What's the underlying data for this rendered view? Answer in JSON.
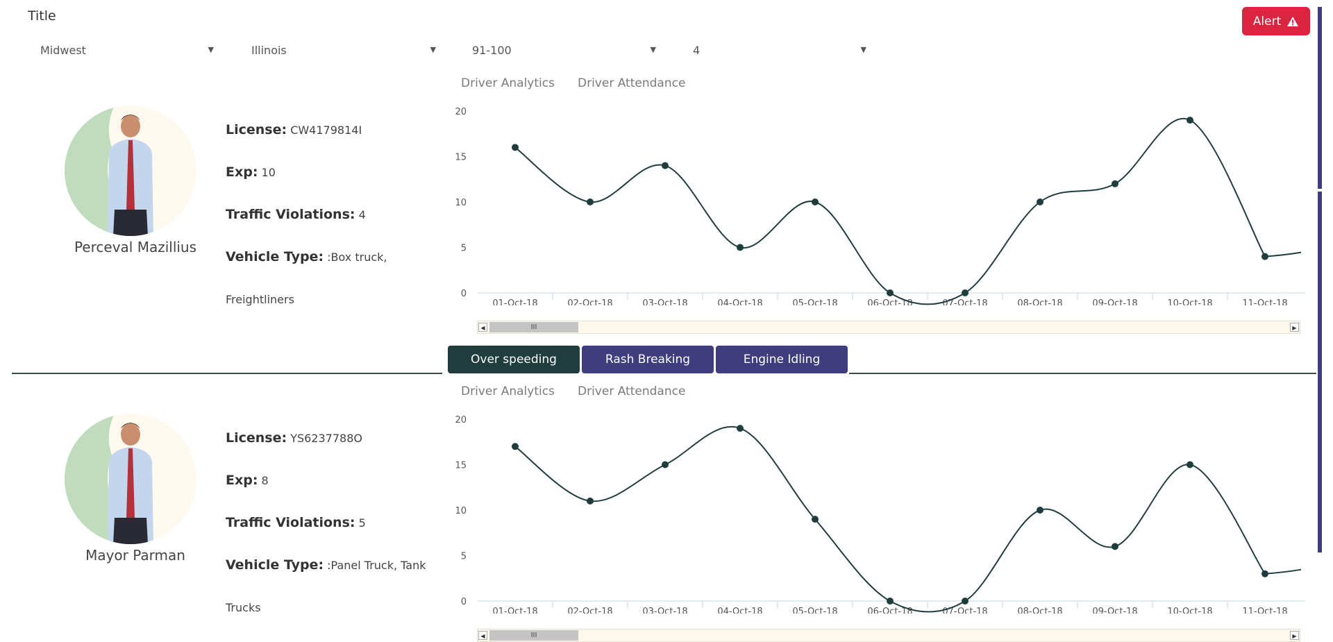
{
  "header": {
    "title": "Title",
    "alert_label": "Alert"
  },
  "filters": [
    {
      "value": "Midwest"
    },
    {
      "value": "Illinois"
    },
    {
      "value": "91-100"
    },
    {
      "value": "4"
    }
  ],
  "metrics": {
    "over_speeding": "Over speeding",
    "rash_breaking": "Rash Breaking",
    "engine_idling": "Engine Idling"
  },
  "colors": {
    "alert": "#dc2340",
    "active_metric": "#1f3d3c",
    "metric": "#3f3d7e",
    "line": "#1f3d3c"
  },
  "drivers": [
    {
      "name": "Perceval Mazillius",
      "license_label": "License:",
      "license": "CW4179814I",
      "exp_label": "Exp:",
      "exp": "10",
      "violations_label": "Traffic Violations:",
      "violations": "4",
      "vehicle_label": "Vehicle Type:",
      "vehicle_line1": ":Box truck,",
      "vehicle_line2": "Freightliners",
      "tabs": [
        "Driver Analytics",
        "Driver Attendance"
      ],
      "chart_data": {
        "type": "line",
        "categories": [
          "01-Oct-18",
          "02-Oct-18",
          "03-Oct-18",
          "04-Oct-18",
          "05-Oct-18",
          "06-Oct-18",
          "07-Oct-18",
          "08-Oct-18",
          "09-Oct-18",
          "10-Oct-18",
          "11-Oct-18"
        ],
        "values": [
          16,
          10,
          14,
          5,
          10,
          0,
          0,
          10,
          12,
          19,
          4
        ],
        "ylim": [
          0,
          20
        ],
        "yticks": [
          0,
          5,
          10,
          15,
          20
        ],
        "grid": false
      }
    },
    {
      "name": "Mayor Parman",
      "license_label": "License:",
      "license": "YS6237788O",
      "exp_label": "Exp:",
      "exp": "8",
      "violations_label": "Traffic Violations:",
      "violations": "5",
      "vehicle_label": "Vehicle Type:",
      "vehicle_line1": ":Panel Truck, Tank",
      "vehicle_line2": "Trucks",
      "tabs": [
        "Driver Analytics",
        "Driver Attendance"
      ],
      "chart_data": {
        "type": "line",
        "categories": [
          "01-Oct-18",
          "02-Oct-18",
          "03-Oct-18",
          "04-Oct-18",
          "05-Oct-18",
          "06-Oct-18",
          "07-Oct-18",
          "08-Oct-18",
          "09-Oct-18",
          "10-Oct-18",
          "11-Oct-18"
        ],
        "values": [
          17,
          11,
          15,
          19,
          9,
          0,
          0,
          10,
          6,
          15,
          3
        ],
        "ylim": [
          0,
          20
        ],
        "yticks": [
          0,
          5,
          10,
          15,
          20
        ],
        "grid": false
      }
    }
  ]
}
